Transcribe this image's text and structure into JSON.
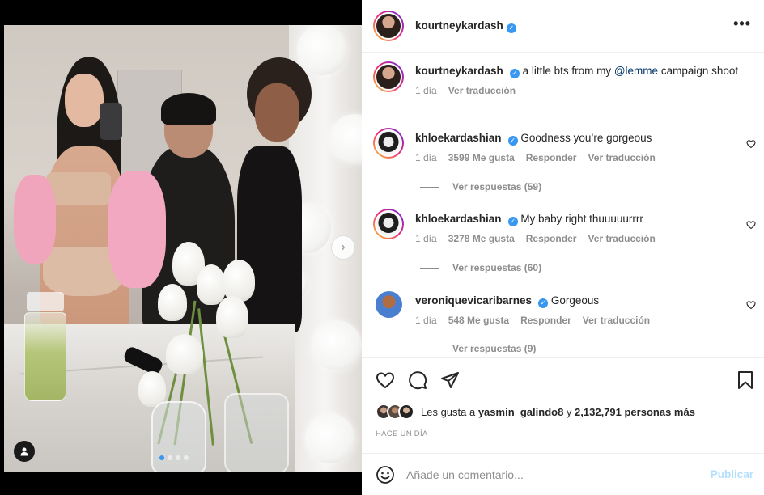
{
  "post": {
    "author": "kourtneykardash",
    "caption": "a little bts from my ",
    "caption_mention": "@lemme",
    "caption_after": " campaign shoot",
    "caption_time": "1 día",
    "caption_translate": "Ver traducción"
  },
  "comments": [
    {
      "username": "khloekardashian",
      "text": "Goodness you’re gorgeous",
      "time": "1 día",
      "likes": "3599 Me gusta",
      "reply": "Responder",
      "translate": "Ver traducción",
      "replies": "Ver respuestas (59)"
    },
    {
      "username": "khloekardashian",
      "text": "My baby right thuuuuurrrr",
      "time": "1 día",
      "likes": "3278 Me gusta",
      "reply": "Responder",
      "translate": "Ver traducción",
      "replies": "Ver respuestas (60)"
    },
    {
      "username": "veroniquevicaribarnes",
      "text": "Gorgeous",
      "time": "1 día",
      "likes": "548 Me gusta",
      "reply": "Responder",
      "translate": "Ver traducción",
      "replies": "Ver respuestas (9)"
    }
  ],
  "likes": {
    "prefix": "Les gusta a ",
    "user": "yasmin_galindo8",
    "middle": " y ",
    "count": "2,132,791 personas más"
  },
  "time_ago": "HACE UN DÍA",
  "comment_box": {
    "placeholder": "Añade un comentario...",
    "publish": "Publicar"
  },
  "carousel": {
    "slides": 4,
    "active_index": 0
  },
  "colors": {
    "accent": "#3897f0",
    "publish_disabled": "#b2dffc",
    "meta": "#8e8e8e"
  },
  "icons": [
    "more-options-icon",
    "verified-icon",
    "heart-icon",
    "comment-icon",
    "share-icon",
    "bookmark-icon",
    "emoji-icon",
    "chevron-right-icon",
    "user-tag-icon"
  ]
}
